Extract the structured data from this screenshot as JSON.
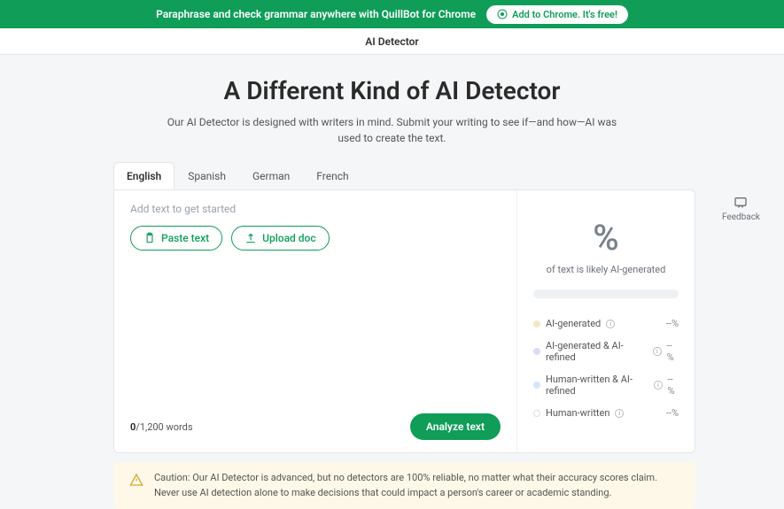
{
  "banner": {
    "text": "Paraphrase and check grammar anywhere with QuillBot for Chrome",
    "button": "Add to Chrome. It's free!"
  },
  "subheader": "AI Detector",
  "title": "A Different Kind of AI Detector",
  "subtitle": "Our AI Detector is designed with writers in mind. Submit your writing to see if—and how—AI was used to create the text.",
  "tabs": [
    "English",
    "Spanish",
    "German",
    "French"
  ],
  "editor": {
    "placeholder": "Add text to get started",
    "paste_label": "Paste text",
    "upload_label": "Upload doc",
    "word_count_current": "0",
    "word_count_sep": "/",
    "word_count_max": "1,200 words",
    "analyze_label": "Analyze text"
  },
  "result": {
    "percent": "%",
    "caption": "of text is likely AI-generated",
    "legend": [
      {
        "label": "AI-generated",
        "color": "#f2e8c7",
        "pct": "--%"
      },
      {
        "label": "AI-generated & AI-refined",
        "color": "#e4d7f6",
        "pct": "--%"
      },
      {
        "label": "Human-written & AI-refined",
        "color": "#d4e6fb",
        "pct": "--%"
      },
      {
        "label": "Human-written",
        "color": "#ffffff",
        "pct": "--%"
      }
    ]
  },
  "feedback_label": "Feedback",
  "caution": "Caution: Our AI Detector is advanced, but no detectors are 100% reliable, no matter what their accuracy scores claim. Never use AI detection alone to make decisions that could impact a person's career or academic standing."
}
